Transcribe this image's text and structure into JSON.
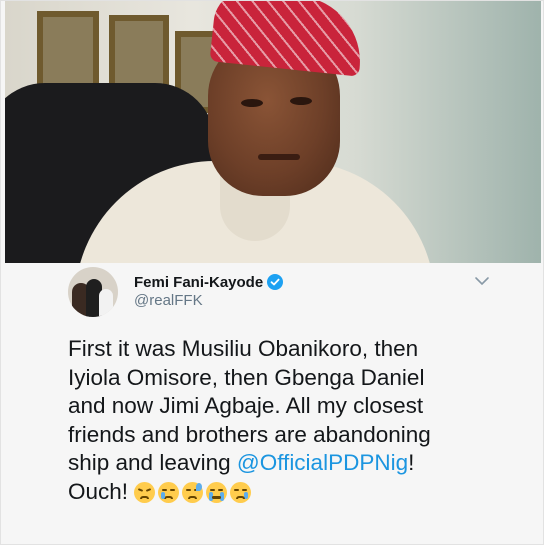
{
  "tweet": {
    "display_name": "Femi Fani-Kayode",
    "handle": "@realFFK",
    "verified": true,
    "text_line1": "First it was Musiliu Obanikoro, then",
    "text_line2": "Iyiola Omisore, then Gbenga Daniel",
    "text_line3": "and now Jimi Agbaje. All my closest",
    "text_line4": "friends and brothers are abandoning",
    "text_line5_pre": "ship and leaving ",
    "mention": "@OfficialPDPNig",
    "text_line5_post": "!",
    "text_line6": "Ouch!",
    "emojis": [
      "disappointed-face-icon",
      "disappointed-relieved-face-icon",
      "downcast-sweat-face-icon",
      "loudly-crying-face-icon",
      "crying-face-icon"
    ]
  },
  "colors": {
    "name": "#14171a",
    "handle": "#657786",
    "mention": "#1b95e0",
    "verified": "#1da1f2",
    "hat": "#c9243b"
  },
  "icons": {
    "verified": "verified-badge-icon",
    "menu": "chevron-down-icon"
  }
}
